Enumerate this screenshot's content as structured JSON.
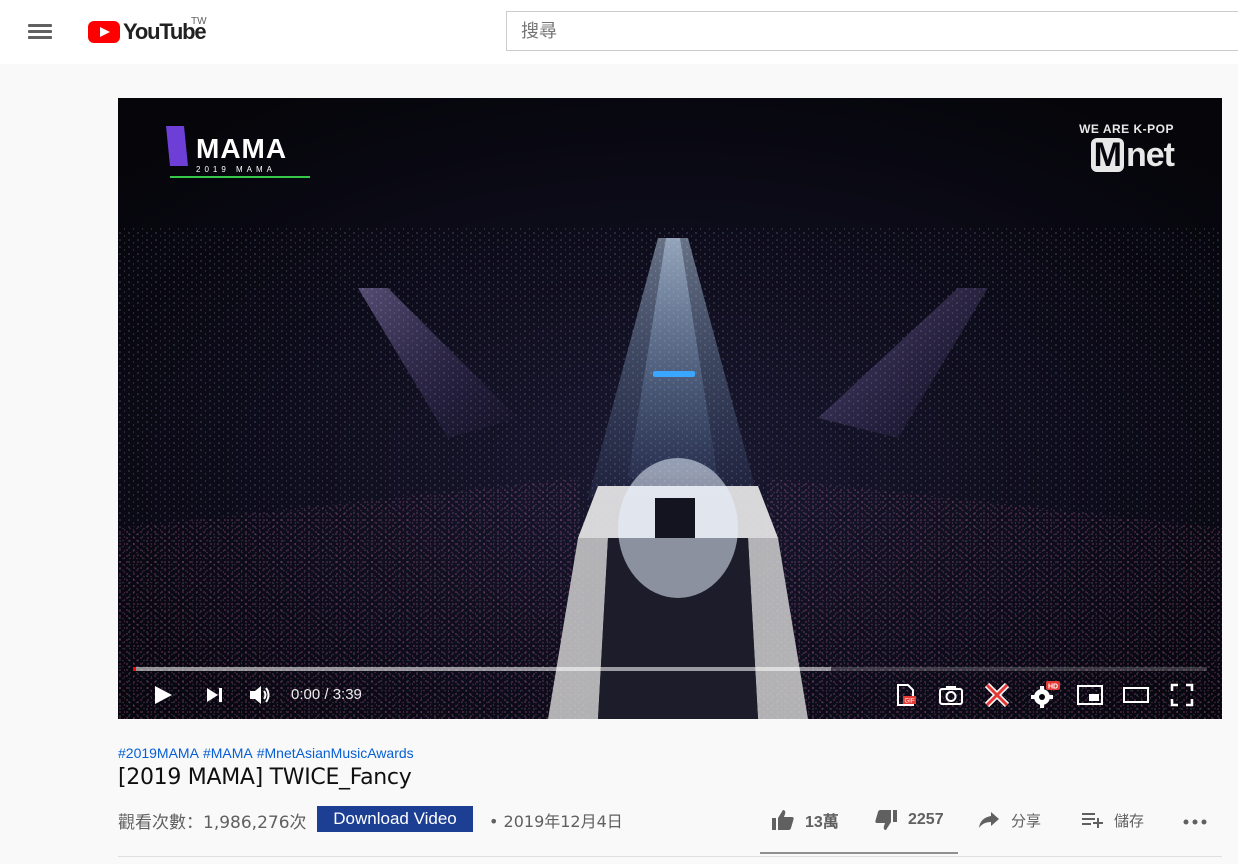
{
  "masthead": {
    "logo_text": "YouTube",
    "region": "TW",
    "search_placeholder": "搜尋"
  },
  "player": {
    "time_display": "0:00 / 3:39",
    "progress_played_fraction": 0.003,
    "progress_loaded_fraction": 0.65,
    "overlay_left_logo": "MAMA",
    "overlay_left_sub": "2019 MAMA",
    "overlay_right_small": "WE ARE K-POP",
    "overlay_right_big_m": "M",
    "overlay_right_big_rest": "net"
  },
  "video": {
    "hashtags": [
      "#2019MAMA",
      "#MAMA",
      "#MnetAsianMusicAwards"
    ],
    "title": "[2019 MAMA] TWICE_Fancy",
    "views": "觀看次數：1,986,276次",
    "download_label": "Download Video",
    "date": "• 2019年12月4日"
  },
  "actions": {
    "like": "13萬",
    "dislike": "2257",
    "share": "分享",
    "save": "儲存",
    "like_ratio": 0.98
  },
  "colors": {
    "brand_red": "#ff0000",
    "link_blue": "#065fd4",
    "download_button_bg": "#1c3f94"
  }
}
